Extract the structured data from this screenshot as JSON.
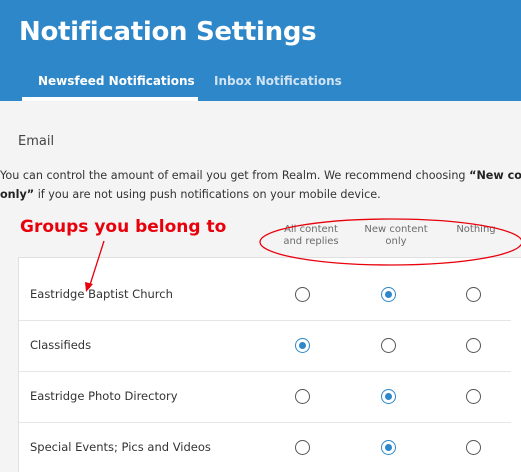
{
  "header": {
    "title": "Notification Settings",
    "tabs": [
      {
        "label": "Newsfeed Notifications",
        "active": true
      },
      {
        "label": "Inbox Notifications",
        "active": false
      }
    ]
  },
  "section": {
    "title": "Email",
    "description_parts": {
      "before": "You can control the amount of email you get from Realm. We recommend choosing ",
      "highlight_1": "“New content",
      "highlight_2": "only”",
      "after": " if you are not using push notifications on your mobile device."
    }
  },
  "annotation": {
    "label": "Groups you belong to",
    "color": "#e8000b"
  },
  "columns": [
    {
      "label": "All content and replies"
    },
    {
      "label": "New content only"
    },
    {
      "label": "Nothing"
    }
  ],
  "groups": [
    {
      "name": "Eastridge Baptist Church",
      "selected_option": 1
    },
    {
      "name": "Classifieds",
      "selected_option": 0
    },
    {
      "name": "Eastridge Photo Directory",
      "selected_option": 1
    },
    {
      "name": "Special Events; Pics and Videos",
      "selected_option": 1
    }
  ],
  "colors": {
    "header_blue": "#2e87c8",
    "radio_selected": "#2e87c8",
    "background": "#f4f4f4"
  }
}
